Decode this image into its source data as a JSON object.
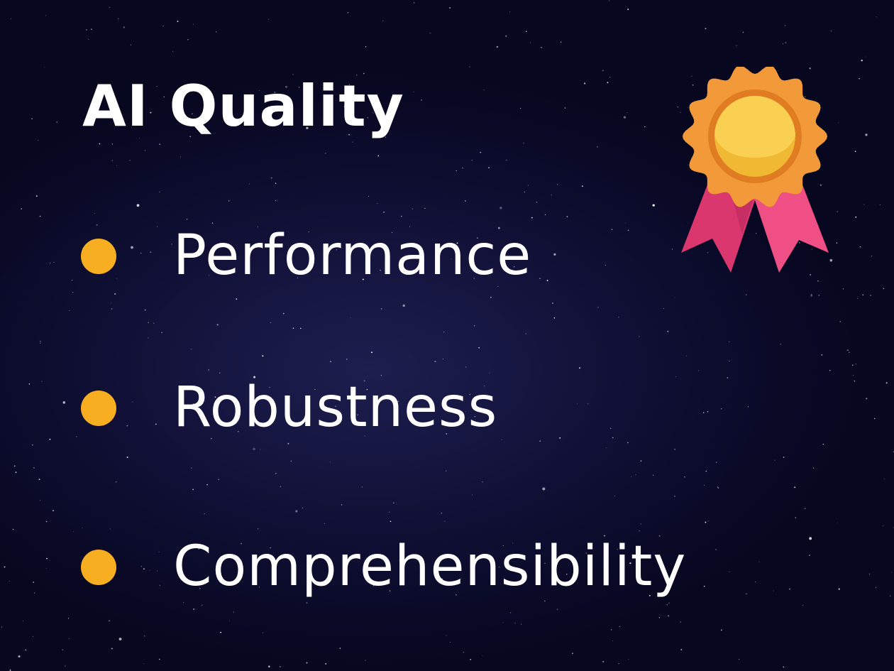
{
  "slide": {
    "title": "AI Quality",
    "bullets": [
      {
        "label": "Performance"
      },
      {
        "label": "Robustness"
      },
      {
        "label": "Comprehensibility"
      }
    ]
  },
  "icons": {
    "bullet": "bullet-dot-icon",
    "badge": "award-medal-icon"
  },
  "colors": {
    "background": "#0b0b2b",
    "text": "#ffffff",
    "bullet": "#f7ae20",
    "medal_outer": "#f29a3a",
    "medal_ring": "#e07d22",
    "medal_inner": "#f7c740",
    "ribbon_left": "#d9376e",
    "ribbon_right": "#f04f86"
  }
}
